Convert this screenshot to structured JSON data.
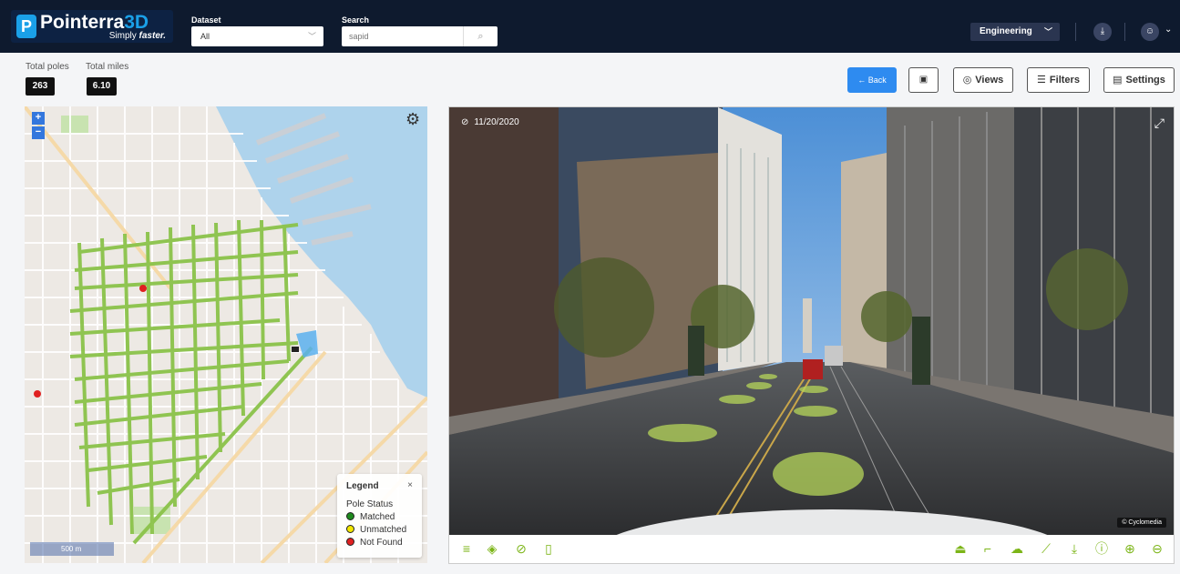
{
  "app": {
    "logo_name": "Pointerra",
    "logo_accent": "3D",
    "tagline_prefix": "Simply ",
    "tagline_emph": "faster.",
    "brand_color": "#1aa0e8",
    "accent_color": "#7cb518"
  },
  "header": {
    "dataset_label": "Dataset",
    "dataset_value": "All",
    "search_label": "Search",
    "search_placeholder": "sapid",
    "role_value": "Engineering"
  },
  "stats": {
    "total_poles_label": "Total poles",
    "total_poles_value": "263",
    "total_miles_label": "Total miles",
    "total_miles_value": "6.10"
  },
  "toolbar": {
    "back_label": "← Back",
    "views_label": "Views",
    "filters_label": "Filters",
    "settings_label": "Settings"
  },
  "map": {
    "zoom_in": "+",
    "zoom_out": "−",
    "scale_label": "500 m",
    "legend": {
      "title": "Legend",
      "close": "×",
      "subtitle": "Pole Status",
      "items": [
        {
          "label": "Matched",
          "color": "#1e8a1e"
        },
        {
          "label": "Unmatched",
          "color": "#f2e600"
        },
        {
          "label": "Not Found",
          "color": "#e02020"
        }
      ]
    }
  },
  "street_view": {
    "date": "11/20/2020",
    "credit": "© Cyclomedia",
    "icons_left": [
      "menu-icon",
      "layers-icon",
      "visibility-off-icon",
      "comment-icon"
    ],
    "icons_right": [
      "upload-icon",
      "annotation-icon",
      "cloud-icon",
      "measure-icon",
      "download-icon",
      "info-icon",
      "zoom-in-icon",
      "zoom-out-icon"
    ]
  }
}
